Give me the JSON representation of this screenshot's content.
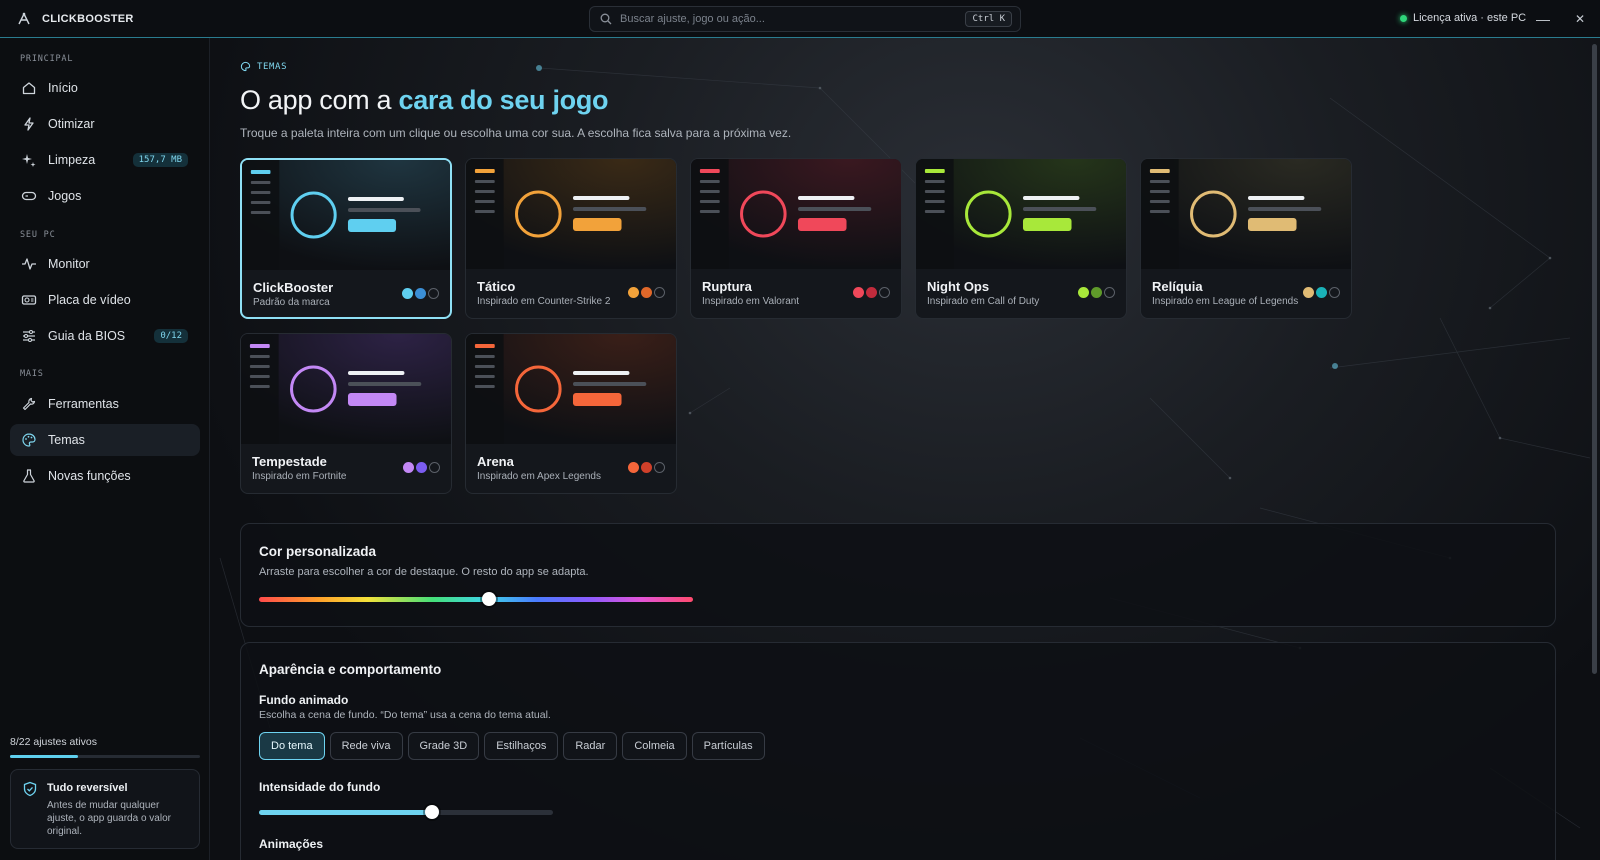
{
  "app": {
    "name": "CLICKBOOSTER"
  },
  "search": {
    "placeholder": "Buscar ajuste, jogo ou ação...",
    "shortcut": "Ctrl K"
  },
  "license": {
    "label": "Licença ativa · este PC",
    "status_color": "#2fd67a"
  },
  "window": {
    "minimize": "—",
    "close": "✕"
  },
  "sidebar": {
    "sections": [
      {
        "label": "PRINCIPAL"
      },
      {
        "label": "SEU PC"
      },
      {
        "label": "MAIS"
      }
    ],
    "items": [
      {
        "label": "Início",
        "icon": "home-icon"
      },
      {
        "label": "Otimizar",
        "icon": "bolt-icon"
      },
      {
        "label": "Limpeza",
        "icon": "sparkle-icon",
        "badge": "157,7 MB"
      },
      {
        "label": "Jogos",
        "icon": "gamepad-icon"
      },
      {
        "label": "Monitor",
        "icon": "pulse-icon"
      },
      {
        "label": "Placa de vídeo",
        "icon": "gpu-icon"
      },
      {
        "label": "Guia da BIOS",
        "icon": "sliders-icon",
        "badge": "0/12"
      },
      {
        "label": "Ferramentas",
        "icon": "wrench-icon"
      },
      {
        "label": "Temas",
        "icon": "palette-icon",
        "active": true
      },
      {
        "label": "Novas funções",
        "icon": "flask-icon"
      }
    ],
    "progress": {
      "label": "8/22 ajustes ativos",
      "fraction": 0.36
    },
    "info": {
      "title": "Tudo reversível",
      "text": "Antes de mudar qualquer ajuste, o app guarda o valor original.",
      "icon": "shield-check-icon"
    }
  },
  "main": {
    "eyebrow": "TEMAS",
    "title_prefix": "O app com a ",
    "title_accent": "cara do seu jogo",
    "subtitle": "Troque a paleta inteira com um clique ou escolha uma cor sua. A escolha fica salva para a próxima vez.",
    "themes": [
      {
        "name": "ClickBooster",
        "subtitle": "Padrão da marca",
        "accent": "#5fcff0",
        "accent2": "#3b8fd6",
        "tint": "#1f3540",
        "selected": true
      },
      {
        "name": "Tático",
        "subtitle": "Inspirado em Counter-Strike 2",
        "accent": "#f2a23a",
        "accent2": "#e0682a",
        "tint": "#3a2a16"
      },
      {
        "name": "Ruptura",
        "subtitle": "Inspirado em Valorant",
        "accent": "#f0485a",
        "accent2": "#c22b3c",
        "tint": "#3a1820"
      },
      {
        "name": "Night Ops",
        "subtitle": "Inspirado em Call of Duty",
        "accent": "#a8e83a",
        "accent2": "#5f9a2a",
        "tint": "#25351a"
      },
      {
        "name": "Relíquia",
        "subtitle": "Inspirado em League of Legends",
        "accent": "#e0bb74",
        "accent2": "#1ab2b8",
        "tint": "#2a2a22"
      },
      {
        "name": "Tempestade",
        "subtitle": "Inspirado em Fortnite",
        "accent": "#c388f5",
        "accent2": "#7b5cf0",
        "tint": "#2d2245"
      },
      {
        "name": "Arena",
        "subtitle": "Inspirado em Apex Legends",
        "accent": "#f5663a",
        "accent2": "#d0402a",
        "tint": "#3a1f18"
      }
    ],
    "custom_color": {
      "title": "Cor personalizada",
      "text": "Arraste para escolher a cor de destaque. O resto do app se adapta.",
      "hue_fraction": 0.53
    },
    "appearance": {
      "title": "Aparência e comportamento",
      "background_title": "Fundo animado",
      "background_text": "Escolha a cena de fundo. “Do tema” usa a cena do tema atual.",
      "scenes": [
        "Do tema",
        "Rede viva",
        "Grade 3D",
        "Estilhaços",
        "Radar",
        "Colmeia",
        "Partículas"
      ],
      "active_scene": 0,
      "intensity_title": "Intensidade do fundo",
      "intensity_fraction": 0.59,
      "animations_title": "Animações"
    }
  }
}
